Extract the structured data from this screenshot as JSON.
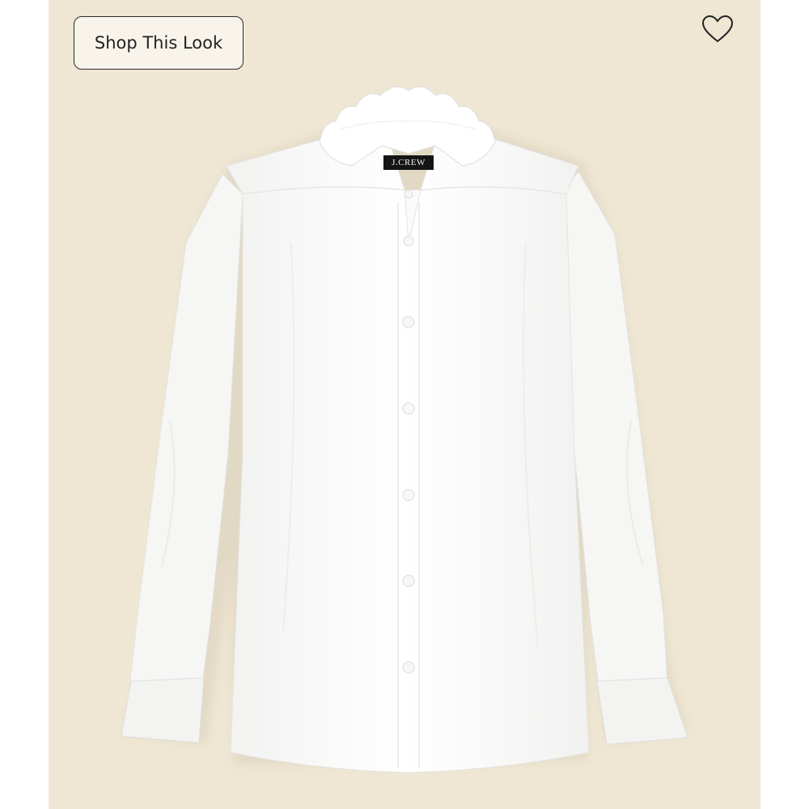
{
  "shop_look": {
    "label": "Shop This Look"
  },
  "wishlist": {
    "icon": "heart-outline-icon"
  },
  "product_image": {
    "brand_tag": "J.CREW",
    "colors": {
      "background": "#efe6d3",
      "shirt": "#ffffff"
    }
  }
}
